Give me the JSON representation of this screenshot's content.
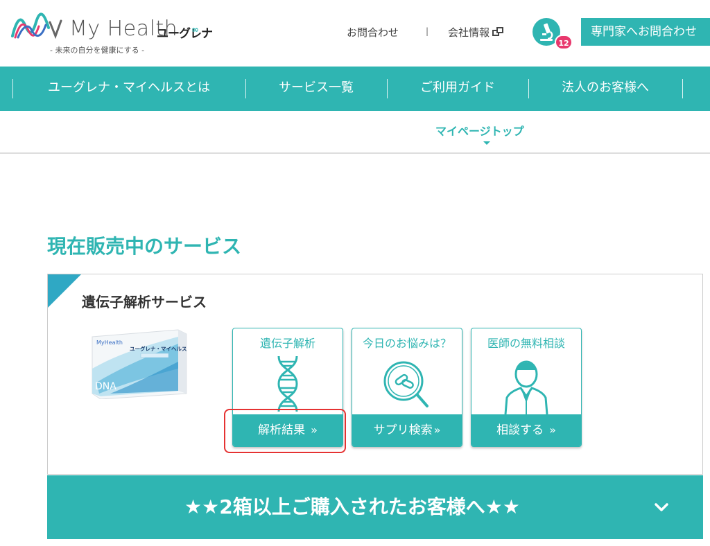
{
  "header": {
    "logo_text": "My Health",
    "logo_jp": "ユーグレナ",
    "logo_symbol": "∞",
    "tagline": "- 未来の自分を健康にする -",
    "contact_label": "お問合わせ",
    "separator": "|",
    "company_label": "会社情報",
    "notification_count": "12",
    "expert_button_label": "専門家へお問合わせ"
  },
  "nav": {
    "items": [
      {
        "label": "ユーグレナ・マイヘルスとは"
      },
      {
        "label": "サービス一覧"
      },
      {
        "label": "ご利用ガイド"
      },
      {
        "label": "法人のお客様へ"
      }
    ]
  },
  "subnav": {
    "active_label": "マイページトップ"
  },
  "main": {
    "section_title": "現在販売中のサービス",
    "card": {
      "title": "遺伝子解析サービス",
      "product_box_label": "ユーグレナ・マイヘルス",
      "product_dna_text": "DNA",
      "tiles": [
        {
          "title": "遺伝子解析",
          "button": "解析結果",
          "icon": "dna-helix-icon"
        },
        {
          "title": "今日のお悩みは？",
          "button": "サプリ検索",
          "icon": "magnifier-pills-icon"
        },
        {
          "title": "医師の無料相談",
          "button": "相談する",
          "icon": "doctor-icon"
        }
      ],
      "chevron": "»"
    },
    "promo_text": "★★2箱以上ご購入されたお客様へ★★"
  },
  "colors": {
    "teal": "#2fb5b2",
    "badge": "#e8386d",
    "highlight": "#e53232"
  }
}
